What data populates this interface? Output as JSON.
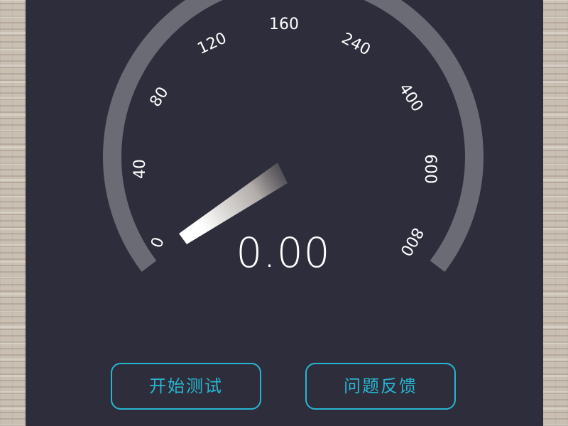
{
  "speedometer": {
    "scale_labels": [
      "0",
      "40",
      "80",
      "120",
      "160",
      "240",
      "400",
      "600",
      "800"
    ],
    "reading": "0.00",
    "needle_value": 0
  },
  "actions": {
    "start_test_label": "开始测试",
    "feedback_label": "问题反馈"
  },
  "colors": {
    "panel_background": "#2e2d3b",
    "gauge_track": "#6b6b76",
    "button_accent": "#27b6d1",
    "text": "#ffffff"
  }
}
